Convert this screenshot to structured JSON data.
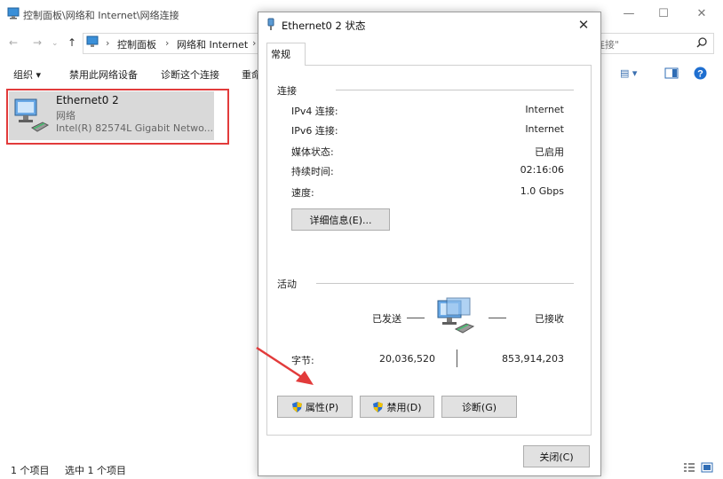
{
  "explorer": {
    "window_title": "控制面板\\网络和 Internet\\网络连接",
    "breadcrumb": [
      "控制面板",
      "网络和 Internet"
    ],
    "search_placeholder": "连接\"",
    "commands": [
      "组织 ▾",
      "禁用此网络设备",
      "诊断这个连接",
      "重命"
    ],
    "adapter": {
      "name": "Ethernet0 2",
      "type": "网络",
      "device": "Intel(R) 82574L Gigabit Netwo..."
    },
    "status": {
      "item_count": "1 个项目",
      "selected": "选中 1 个项目"
    }
  },
  "dialog": {
    "title": "Ethernet0 2 状态",
    "tab": "常规",
    "connection_section": "连接",
    "rows": [
      {
        "label": "IPv4 连接:",
        "value": "Internet"
      },
      {
        "label": "IPv6 连接:",
        "value": "Internet"
      },
      {
        "label": "媒体状态:",
        "value": "已启用"
      },
      {
        "label": "持续时间:",
        "value": "02:16:06"
      },
      {
        "label": "速度:",
        "value": "1.0 Gbps"
      }
    ],
    "details_button": "详细信息(E)...",
    "activity_section": "活动",
    "sent_label": "已发送",
    "received_label": "已接收",
    "bytes_label": "字节:",
    "bytes_sent": "20,036,520",
    "bytes_received": "853,914,203",
    "properties_button": "属性(P)",
    "disable_button": "禁用(D)",
    "diagnose_button": "诊断(G)",
    "close_button": "关闭(C)"
  },
  "colors": {
    "highlight_border": "#e23b3b",
    "annotation_arrow": "#e23b3b",
    "button_face": "#e1e1e1"
  }
}
